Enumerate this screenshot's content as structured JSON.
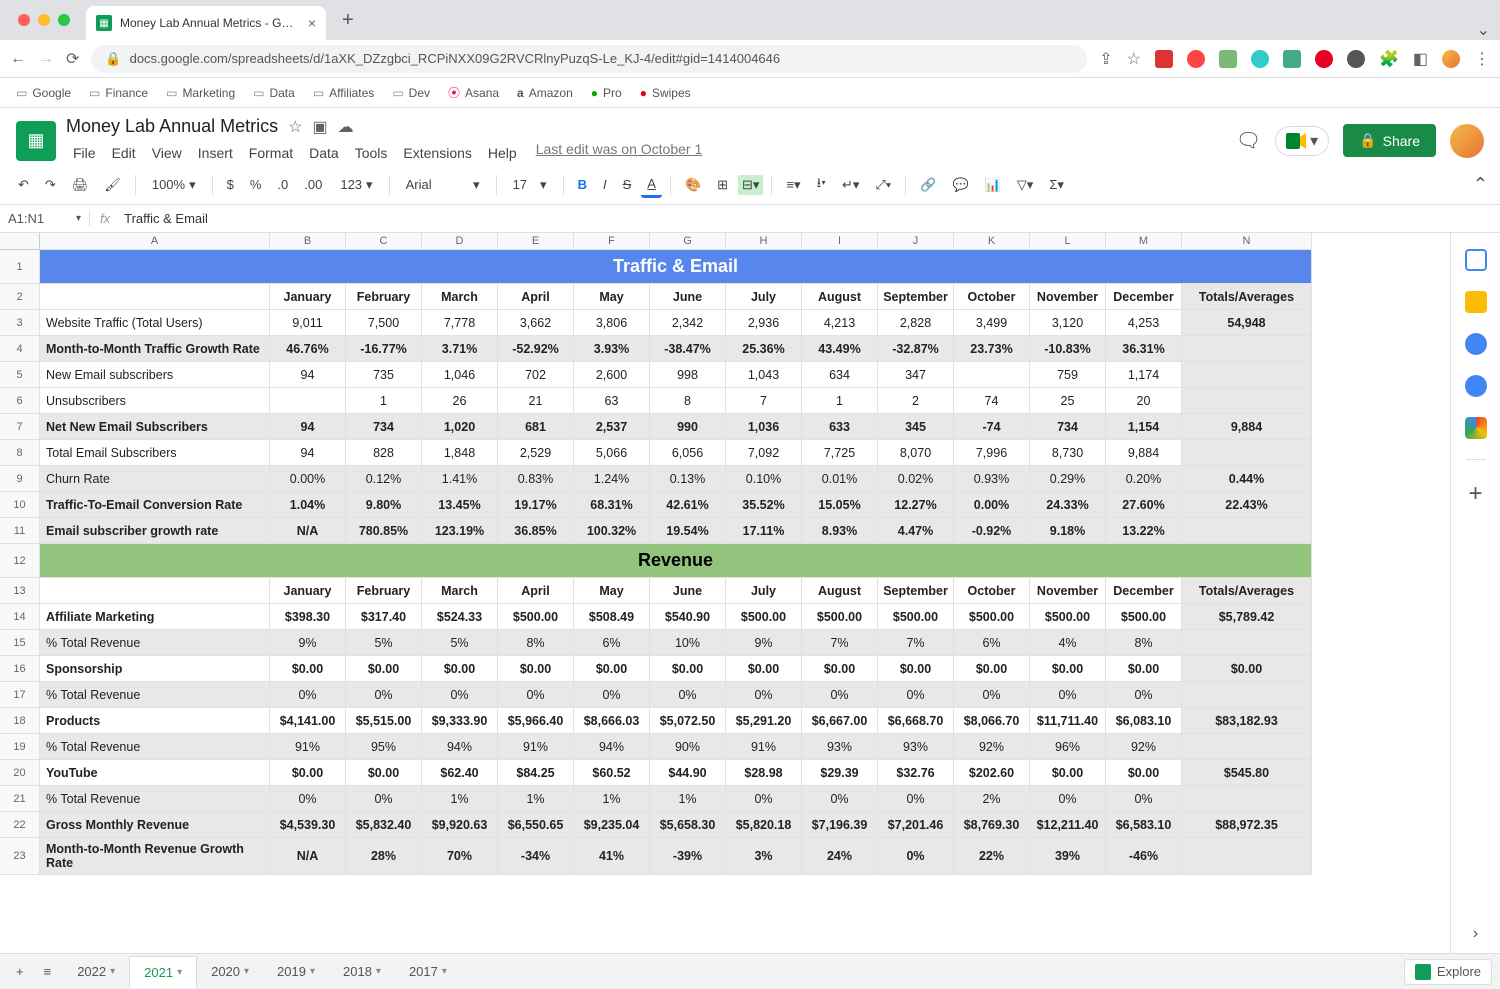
{
  "browser": {
    "tab_title": "Money Lab Annual Metrics - G…",
    "url": "docs.google.com/spreadsheets/d/1aXK_DZzgbci_RCPiNXX09G2RVCRlnyPuzqS-Le_KJ-4/edit#gid=1414004646",
    "bookmarks": [
      "Google",
      "Finance",
      "Marketing",
      "Data",
      "Affiliates",
      "Dev",
      "Asana",
      "Amazon",
      "Pro",
      "Swipes"
    ]
  },
  "doc": {
    "title": "Money Lab Annual Metrics",
    "menus": [
      "File",
      "Edit",
      "View",
      "Insert",
      "Format",
      "Data",
      "Tools",
      "Extensions",
      "Help"
    ],
    "last_edit": "Last edit was on October 1",
    "share": "Share"
  },
  "toolbar": {
    "zoom": "100%",
    "font": "Arial",
    "size": "17"
  },
  "formula": {
    "name_box": "A1:N1",
    "content": "Traffic & Email"
  },
  "columns": [
    "A",
    "B",
    "C",
    "D",
    "E",
    "F",
    "G",
    "H",
    "I",
    "J",
    "K",
    "L",
    "M",
    "N"
  ],
  "months": [
    "January",
    "February",
    "March",
    "April",
    "May",
    "June",
    "July",
    "August",
    "September",
    "October",
    "November",
    "December"
  ],
  "totals_label": "Totals/Averages",
  "section1": "Traffic & Email",
  "section2": "Revenue",
  "rows_traffic": [
    {
      "n": 3,
      "label": "Website Traffic (Total Users)",
      "bold": false,
      "shade": false,
      "vals": [
        "9,011",
        "7,500",
        "7,778",
        "3,662",
        "3,806",
        "2,342",
        "2,936",
        "4,213",
        "2,828",
        "3,499",
        "3,120",
        "4,253"
      ],
      "total": "54,948"
    },
    {
      "n": 4,
      "label": "Month-to-Month Traffic Growth Rate",
      "bold": true,
      "shade": true,
      "vals": [
        "46.76%",
        "-16.77%",
        "3.71%",
        "-52.92%",
        "3.93%",
        "-38.47%",
        "25.36%",
        "43.49%",
        "-32.87%",
        "23.73%",
        "-10.83%",
        "36.31%"
      ],
      "total": ""
    },
    {
      "n": 5,
      "label": "New Email subscribers",
      "bold": false,
      "shade": false,
      "vals": [
        "94",
        "735",
        "1,046",
        "702",
        "2,600",
        "998",
        "1,043",
        "634",
        "347",
        "",
        "759",
        "1,174"
      ],
      "total": ""
    },
    {
      "n": 6,
      "label": "Unsubscribers",
      "bold": false,
      "shade": false,
      "vals": [
        "",
        "1",
        "26",
        "21",
        "63",
        "8",
        "7",
        "1",
        "2",
        "74",
        "25",
        "20"
      ],
      "total": ""
    },
    {
      "n": 7,
      "label": "Net New Email Subscribers",
      "bold": true,
      "shade": true,
      "vals": [
        "94",
        "734",
        "1,020",
        "681",
        "2,537",
        "990",
        "1,036",
        "633",
        "345",
        "-74",
        "734",
        "1,154"
      ],
      "total": "9,884"
    },
    {
      "n": 8,
      "label": "Total Email Subscribers",
      "bold": false,
      "shade": false,
      "vals": [
        "94",
        "828",
        "1,848",
        "2,529",
        "5,066",
        "6,056",
        "7,092",
        "7,725",
        "8,070",
        "7,996",
        "8,730",
        "9,884"
      ],
      "total": ""
    },
    {
      "n": 9,
      "label": "Churn Rate",
      "bold": false,
      "shade": true,
      "vals": [
        "0.00%",
        "0.12%",
        "1.41%",
        "0.83%",
        "1.24%",
        "0.13%",
        "0.10%",
        "0.01%",
        "0.02%",
        "0.93%",
        "0.29%",
        "0.20%"
      ],
      "total": "0.44%"
    },
    {
      "n": 10,
      "label": "Traffic-To-Email Conversion Rate",
      "bold": true,
      "shade": true,
      "vals": [
        "1.04%",
        "9.80%",
        "13.45%",
        "19.17%",
        "68.31%",
        "42.61%",
        "35.52%",
        "15.05%",
        "12.27%",
        "0.00%",
        "24.33%",
        "27.60%"
      ],
      "total": "22.43%"
    },
    {
      "n": 11,
      "label": "Email subscriber growth rate",
      "bold": true,
      "shade": true,
      "vals": [
        "N/A",
        "780.85%",
        "123.19%",
        "36.85%",
        "100.32%",
        "19.54%",
        "17.11%",
        "8.93%",
        "4.47%",
        "-0.92%",
        "9.18%",
        "13.22%"
      ],
      "total": ""
    }
  ],
  "rows_revenue": [
    {
      "n": 14,
      "label": "Affiliate Marketing",
      "bold": true,
      "shade": false,
      "vals": [
        "$398.30",
        "$317.40",
        "$524.33",
        "$500.00",
        "$508.49",
        "$540.90",
        "$500.00",
        "$500.00",
        "$500.00",
        "$500.00",
        "$500.00",
        "$500.00"
      ],
      "total": "$5,789.42"
    },
    {
      "n": 15,
      "label": "% Total Revenue",
      "bold": false,
      "shade": true,
      "vals": [
        "9%",
        "5%",
        "5%",
        "8%",
        "6%",
        "10%",
        "9%",
        "7%",
        "7%",
        "6%",
        "4%",
        "8%"
      ],
      "total": ""
    },
    {
      "n": 16,
      "label": "Sponsorship",
      "bold": true,
      "shade": false,
      "vals": [
        "$0.00",
        "$0.00",
        "$0.00",
        "$0.00",
        "$0.00",
        "$0.00",
        "$0.00",
        "$0.00",
        "$0.00",
        "$0.00",
        "$0.00",
        "$0.00"
      ],
      "total": "$0.00"
    },
    {
      "n": 17,
      "label": "% Total Revenue",
      "bold": false,
      "shade": true,
      "vals": [
        "0%",
        "0%",
        "0%",
        "0%",
        "0%",
        "0%",
        "0%",
        "0%",
        "0%",
        "0%",
        "0%",
        "0%"
      ],
      "total": ""
    },
    {
      "n": 18,
      "label": "Products",
      "bold": true,
      "shade": false,
      "vals": [
        "$4,141.00",
        "$5,515.00",
        "$9,333.90",
        "$5,966.40",
        "$8,666.03",
        "$5,072.50",
        "$5,291.20",
        "$6,667.00",
        "$6,668.70",
        "$8,066.70",
        "$11,711.40",
        "$6,083.10"
      ],
      "total": "$83,182.93"
    },
    {
      "n": 19,
      "label": "% Total Revenue",
      "bold": false,
      "shade": true,
      "vals": [
        "91%",
        "95%",
        "94%",
        "91%",
        "94%",
        "90%",
        "91%",
        "93%",
        "93%",
        "92%",
        "96%",
        "92%"
      ],
      "total": ""
    },
    {
      "n": 20,
      "label": "YouTube",
      "bold": true,
      "shade": false,
      "vals": [
        "$0.00",
        "$0.00",
        "$62.40",
        "$84.25",
        "$60.52",
        "$44.90",
        "$28.98",
        "$29.39",
        "$32.76",
        "$202.60",
        "$0.00",
        "$0.00"
      ],
      "total": "$545.80"
    },
    {
      "n": 21,
      "label": "% Total Revenue",
      "bold": false,
      "shade": true,
      "vals": [
        "0%",
        "0%",
        "1%",
        "1%",
        "1%",
        "1%",
        "0%",
        "0%",
        "0%",
        "2%",
        "0%",
        "0%"
      ],
      "total": ""
    },
    {
      "n": 22,
      "label": "Gross Monthly Revenue",
      "bold": true,
      "shade": true,
      "vals": [
        "$4,539.30",
        "$5,832.40",
        "$9,920.63",
        "$6,550.65",
        "$9,235.04",
        "$5,658.30",
        "$5,820.18",
        "$7,196.39",
        "$7,201.46",
        "$8,769.30",
        "$12,211.40",
        "$6,583.10"
      ],
      "total": "$88,972.35"
    },
    {
      "n": 23,
      "label": "Month-to-Month Revenue Growth Rate",
      "bold": true,
      "shade": true,
      "vals": [
        "N/A",
        "28%",
        "70%",
        "-34%",
        "41%",
        "-39%",
        "3%",
        "24%",
        "0%",
        "22%",
        "39%",
        "-46%"
      ],
      "total": ""
    }
  ],
  "sheet_tabs": [
    "2022",
    "2021",
    "2020",
    "2019",
    "2018",
    "2017"
  ],
  "active_tab": "2021",
  "explore": "Explore"
}
